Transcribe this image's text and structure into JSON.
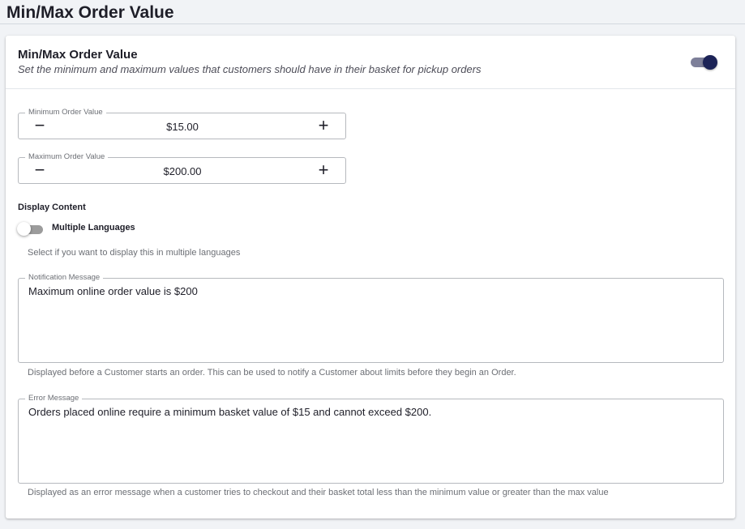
{
  "page": {
    "title": "Min/Max Order Value"
  },
  "card": {
    "title": "Min/Max Order Value",
    "subtitle": "Set the minimum and maximum values that customers should have in their basket for pickup orders",
    "enabled": true
  },
  "min_field": {
    "label": "Minimum Order Value",
    "value": "$15.00",
    "minus": "−",
    "plus": "+"
  },
  "max_field": {
    "label": "Maximum Order Value",
    "value": "$200.00",
    "minus": "−",
    "plus": "+"
  },
  "display_content": {
    "label": "Display Content",
    "multi_lang_label": "Multiple Languages",
    "multi_lang_enabled": false,
    "multi_lang_helper": "Select if you want to display this in multiple languages"
  },
  "notification": {
    "label": "Notification Message",
    "value": "Maximum online order value is $200",
    "helper": "Displayed before a Customer starts an order. This can be used to notify a Customer about limits before they begin an Order."
  },
  "error": {
    "label": "Error Message",
    "value": "Orders placed online require a minimum basket value of $15 and cannot exceed $200.",
    "helper": "Displayed as an error message when a customer tries to checkout and their basket total less than the minimum value or greater than the max value"
  },
  "colors": {
    "accent": "#1c2357",
    "toggle_track": "#7d7f99",
    "border": "#b6b9be"
  }
}
